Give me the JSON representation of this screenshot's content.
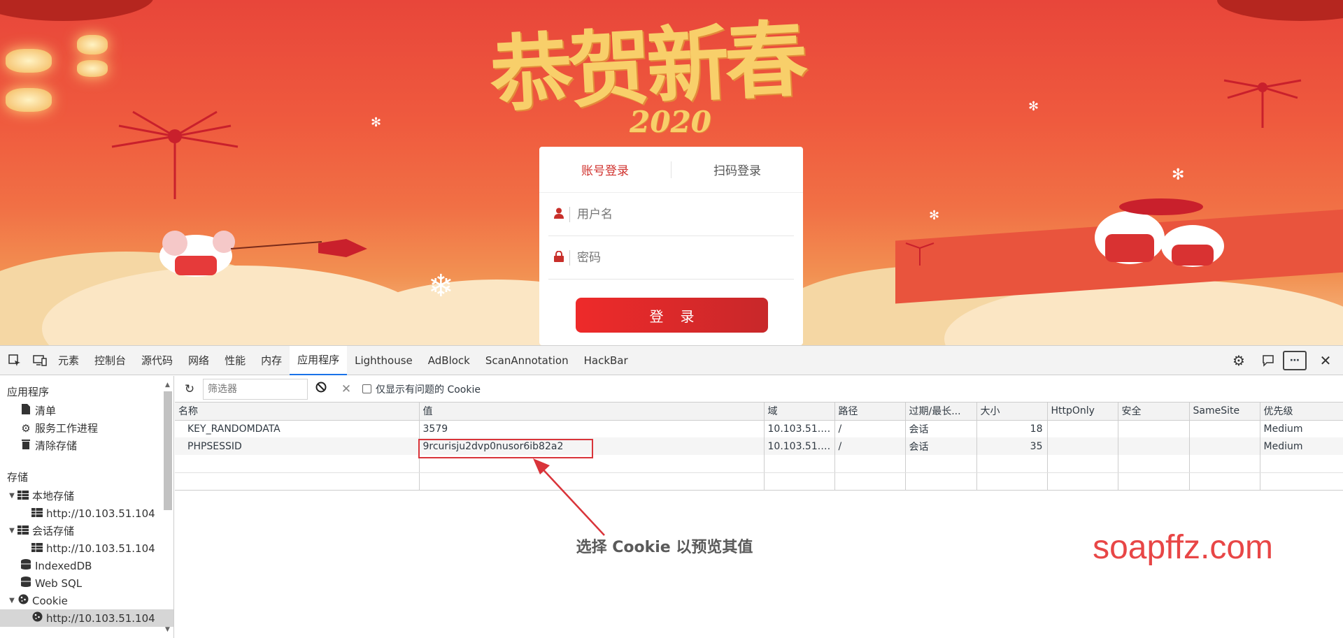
{
  "banner": {
    "title": "恭贺新春",
    "year": "2020",
    "brand": "soapffz.com"
  },
  "login": {
    "tabs": [
      "账号登录",
      "扫码登录"
    ],
    "username_placeholder": "用户名",
    "password_placeholder": "密码",
    "submit_label": "登录"
  },
  "devtools": {
    "tabs": [
      "元素",
      "控制台",
      "源代码",
      "网络",
      "性能",
      "内存",
      "应用程序",
      "Lighthouse",
      "AdBlock",
      "ScanAnnotation",
      "HackBar"
    ],
    "active_tab": "应用程序",
    "sidebar": {
      "app_section": "应用程序",
      "app_items": [
        "清单",
        "服务工作进程",
        "清除存储"
      ],
      "storage_section": "存储",
      "local_storage": "本地存储",
      "local_storage_origin": "http://10.103.51.104",
      "session_storage": "会话存储",
      "session_storage_origin": "http://10.103.51.104",
      "indexeddb": "IndexedDB",
      "websql": "Web SQL",
      "cookie": "Cookie",
      "cookie_origin": "http://10.103.51.104"
    },
    "toolbar": {
      "filter_placeholder": "筛选器",
      "only_issues_label": "仅显示有问题的 Cookie"
    },
    "table": {
      "headers": [
        "名称",
        "值",
        "域",
        "路径",
        "过期/最长...",
        "大小",
        "HttpOnly",
        "安全",
        "SameSite",
        "优先级"
      ],
      "rows": [
        {
          "name": "KEY_RANDOMDATA",
          "value": "3579",
          "domain": "10.103.51.1...",
          "path": "/",
          "expires": "会话",
          "size": "18",
          "httponly": "",
          "secure": "",
          "samesite": "",
          "priority": "Medium"
        },
        {
          "name": "PHPSESSID",
          "value": "9rcurisju2dvp0nusor6ib82a2",
          "domain": "10.103.51.1...",
          "path": "/",
          "expires": "会话",
          "size": "35",
          "httponly": "",
          "secure": "",
          "samesite": "",
          "priority": "Medium"
        }
      ]
    },
    "preview_message": "选择 Cookie 以预览其值"
  },
  "colors": {
    "accent": "#1a73e8",
    "login_red": "#d0312d",
    "highlight": "#d9343a"
  }
}
